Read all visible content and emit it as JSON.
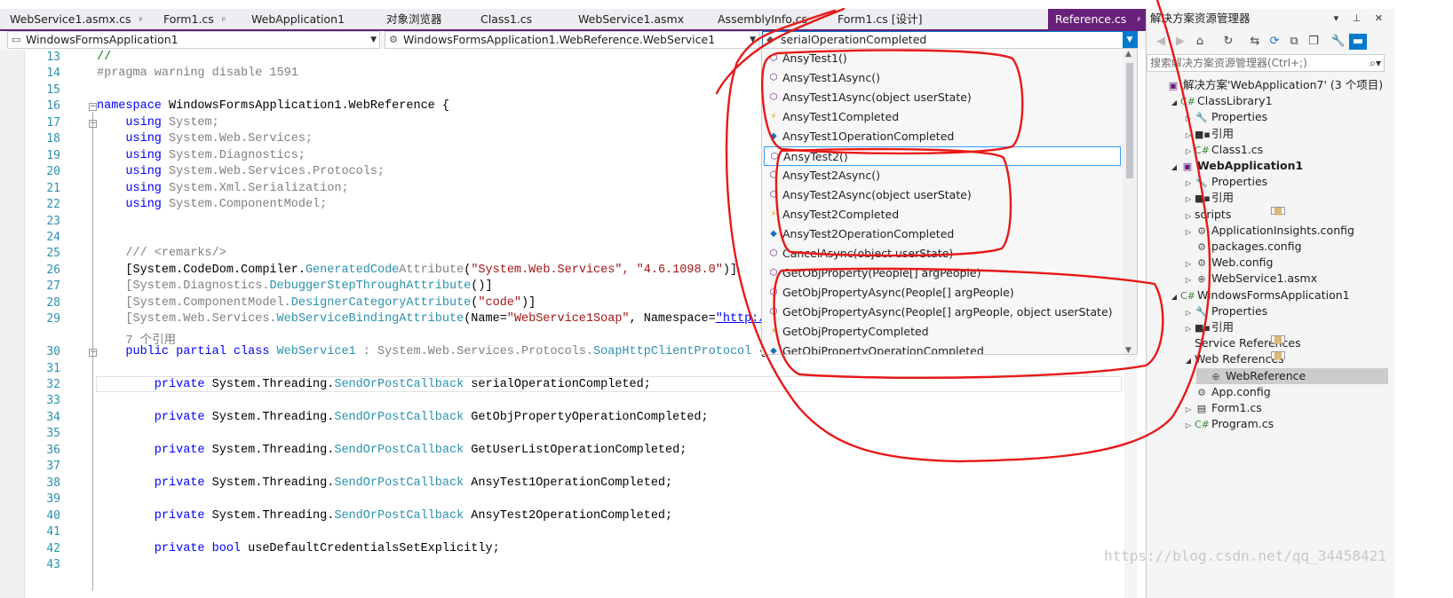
{
  "tabs": [
    {
      "label": "WebService1.asmx.cs",
      "pin": "ᵖ"
    },
    {
      "label": "Form1.cs",
      "pin": "ᵖ"
    },
    {
      "label": "WebApplication1",
      "pin": ""
    },
    {
      "label": "对象浏览器",
      "pin": ""
    },
    {
      "label": "Class1.cs",
      "pin": ""
    },
    {
      "label": "WebService1.asmx",
      "pin": ""
    },
    {
      "label": "AssemblyInfo.cs",
      "pin": ""
    },
    {
      "label": "Form1.cs [设计]",
      "pin": ""
    },
    {
      "label": "Reference.cs",
      "pin": "ᵖ",
      "close": "✕",
      "active": true
    }
  ],
  "tab_overflow": "▾",
  "navbar": {
    "project_combo": "WindowsFormsApplication1",
    "type_combo": "WindowsFormsApplication1.WebReference.WebService1",
    "member_combo": "serialOperationCompleted"
  },
  "editor": {
    "lines": [
      {
        "n": "13",
        "segments": [
          {
            "t": "//",
            "c": "cm"
          }
        ]
      },
      {
        "n": "14",
        "segments": [
          {
            "t": "#pragma warning disable 1591",
            "c": "gr"
          }
        ]
      },
      {
        "n": "15",
        "segments": []
      },
      {
        "n": "16",
        "segments": [
          {
            "t": "namespace",
            "c": "kw"
          },
          {
            "t": " WindowsFormsApplication1.WebReference {",
            "c": ""
          }
        ]
      },
      {
        "n": "17",
        "segments": [
          {
            "t": "    using",
            "c": "kw"
          },
          {
            "t": " System;",
            "c": "gr"
          }
        ]
      },
      {
        "n": "18",
        "segments": [
          {
            "t": "    using",
            "c": "kw"
          },
          {
            "t": " System.Web.Services;",
            "c": "gr"
          }
        ]
      },
      {
        "n": "19",
        "segments": [
          {
            "t": "    using",
            "c": "kw"
          },
          {
            "t": " System.Diagnostics;",
            "c": "gr"
          }
        ]
      },
      {
        "n": "20",
        "segments": [
          {
            "t": "    using",
            "c": "kw"
          },
          {
            "t": " System.Web.Services.Protocols;",
            "c": "gr"
          }
        ]
      },
      {
        "n": "21",
        "segments": [
          {
            "t": "    using",
            "c": "kw"
          },
          {
            "t": " System.Xml.Serialization;",
            "c": "gr"
          }
        ]
      },
      {
        "n": "22",
        "segments": [
          {
            "t": "    using",
            "c": "kw"
          },
          {
            "t": " System.ComponentModel;",
            "c": "gr"
          }
        ]
      },
      {
        "n": "23",
        "segments": []
      },
      {
        "n": "24",
        "segments": []
      },
      {
        "n": "25",
        "segments": [
          {
            "t": "    /// <remarks/>",
            "c": "gr"
          }
        ]
      },
      {
        "n": "26",
        "segments": [
          {
            "t": "    [System.CodeDom.Compiler.",
            "c": ""
          },
          {
            "t": "GeneratedCode",
            "c": "ty"
          },
          {
            "t": "Attribute",
            "c": "gr"
          },
          {
            "t": "(",
            "c": ""
          },
          {
            "t": "\"System.Web.Services\", \"4.6.1098.0\"",
            "c": "str"
          },
          {
            "t": ")]",
            "c": ""
          }
        ]
      },
      {
        "n": "27",
        "segments": [
          {
            "t": "    [System.Diagnostics.",
            "c": "gr"
          },
          {
            "t": "DebuggerStepThroughAttribute",
            "c": "ty"
          },
          {
            "t": "()]",
            "c": ""
          }
        ]
      },
      {
        "n": "28",
        "segments": [
          {
            "t": "    [System.ComponentModel.",
            "c": "gr"
          },
          {
            "t": "DesignerCategoryAttribute",
            "c": "ty"
          },
          {
            "t": "(",
            "c": ""
          },
          {
            "t": "\"code\"",
            "c": "str"
          },
          {
            "t": ")]",
            "c": ""
          }
        ]
      },
      {
        "n": "29",
        "segments": [
          {
            "t": "    [System.Web.Services.",
            "c": "gr"
          },
          {
            "t": "WebServiceBindingAttribute",
            "c": "ty"
          },
          {
            "t": "(Name=",
            "c": ""
          },
          {
            "t": "\"WebService1Soap\"",
            "c": "str"
          },
          {
            "t": ", Namespace=",
            "c": ""
          },
          {
            "t": "\"http://tempuri.org/\"",
            "c": "lk"
          }
        ]
      },
      {
        "n": "",
        "segments": [
          {
            "t": "    7 个引用",
            "c": "gr"
          }
        ]
      },
      {
        "n": "30",
        "segments": [
          {
            "t": "    public partial class",
            "c": "kw"
          },
          {
            "t": " ",
            "c": ""
          },
          {
            "t": "WebService1",
            "c": "ty"
          },
          {
            "t": " : System.Web.Services.Protocols.",
            "c": "gr"
          },
          {
            "t": "SoapHttpClientProtocol",
            "c": "ty"
          },
          {
            "t": " {",
            "c": ""
          }
        ]
      },
      {
        "n": "31",
        "segments": []
      },
      {
        "n": "32",
        "segments": [
          {
            "t": "        private",
            "c": "kw"
          },
          {
            "t": " System.Threading.",
            "c": ""
          },
          {
            "t": "SendOrPostCallback",
            "c": "ty"
          },
          {
            "t": " serialOperationCompleted;",
            "c": ""
          }
        ]
      },
      {
        "n": "33",
        "segments": []
      },
      {
        "n": "34",
        "segments": [
          {
            "t": "        private",
            "c": "kw"
          },
          {
            "t": " System.Threading.",
            "c": ""
          },
          {
            "t": "SendOrPostCallback",
            "c": "ty"
          },
          {
            "t": " GetObjPropertyOperationCompleted;",
            "c": ""
          }
        ]
      },
      {
        "n": "35",
        "segments": []
      },
      {
        "n": "36",
        "segments": [
          {
            "t": "        private",
            "c": "kw"
          },
          {
            "t": " System.Threading.",
            "c": ""
          },
          {
            "t": "SendOrPostCallback",
            "c": "ty"
          },
          {
            "t": " GetUserListOperationCompleted;",
            "c": ""
          }
        ]
      },
      {
        "n": "37",
        "segments": []
      },
      {
        "n": "38",
        "segments": [
          {
            "t": "        private",
            "c": "kw"
          },
          {
            "t": " System.Threading.",
            "c": ""
          },
          {
            "t": "SendOrPostCallback",
            "c": "ty"
          },
          {
            "t": " AnsyTest1OperationCompleted;",
            "c": ""
          }
        ]
      },
      {
        "n": "39",
        "segments": []
      },
      {
        "n": "40",
        "segments": [
          {
            "t": "        private",
            "c": "kw"
          },
          {
            "t": " System.Threading.",
            "c": ""
          },
          {
            "t": "SendOrPostCallback",
            "c": "ty"
          },
          {
            "t": " AnsyTest2OperationCompleted;",
            "c": ""
          }
        ]
      },
      {
        "n": "41",
        "segments": []
      },
      {
        "n": "42",
        "segments": [
          {
            "t": "        private bool",
            "c": "kw"
          },
          {
            "t": " useDefaultCredentialsSetExplicitly;",
            "c": ""
          }
        ]
      },
      {
        "n": "43",
        "segments": []
      }
    ]
  },
  "member_dropdown": {
    "items": [
      {
        "label": "AnsyTest1()",
        "icon": "⬡",
        "kind": "m"
      },
      {
        "label": "AnsyTest1Async()",
        "icon": "⬡",
        "kind": "m"
      },
      {
        "label": "AnsyTest1Async(object userState)",
        "icon": "⬡",
        "kind": "m"
      },
      {
        "label": "AnsyTest1Completed",
        "icon": "⚡",
        "kind": "e"
      },
      {
        "label": "AnsyTest1OperationCompleted",
        "icon": "◆",
        "kind": "f"
      },
      {
        "label": "AnsyTest2()",
        "icon": "⬡",
        "kind": "m",
        "selected": true
      },
      {
        "label": "AnsyTest2Async()",
        "icon": "⬡",
        "kind": "m"
      },
      {
        "label": "AnsyTest2Async(object userState)",
        "icon": "⬡",
        "kind": "m"
      },
      {
        "label": "AnsyTest2Completed",
        "icon": "⚡",
        "kind": "e"
      },
      {
        "label": "AnsyTest2OperationCompleted",
        "icon": "◆",
        "kind": "f"
      },
      {
        "label": "CancelAsync(object userState)",
        "icon": "⬡",
        "kind": "m"
      },
      {
        "label": "GetObjProperty(People[] argPeople)",
        "icon": "⬡",
        "kind": "m"
      },
      {
        "label": "GetObjPropertyAsync(People[] argPeople)",
        "icon": "⬡",
        "kind": "m"
      },
      {
        "label": "GetObjPropertyAsync(People[] argPeople, object userState)",
        "icon": "⬡",
        "kind": "m"
      },
      {
        "label": "GetObjPropertyCompleted",
        "icon": "⚡",
        "kind": "e"
      },
      {
        "label": "GetObjPropertyOperationCompleted",
        "icon": "◆",
        "kind": "f"
      }
    ]
  },
  "solution_explorer": {
    "title": "解决方案资源管理器",
    "controls": "▾ ⊥ ✕",
    "search_placeholder": "搜索解决方案资源管理器(Ctrl+;)",
    "tree": [
      {
        "label": "解决方案'WebApplication7' (3 个项目)",
        "depth": 0,
        "twisty": "",
        "icon": "▣",
        "iclass": "sol"
      },
      {
        "label": "ClassLibrary1",
        "depth": 1,
        "twisty": "◢",
        "icon": "C#",
        "iclass": "cs"
      },
      {
        "label": "Properties",
        "depth": 2,
        "twisty": "▷",
        "icon": "🔧",
        "iclass": "wrench"
      },
      {
        "label": "引用",
        "depth": 2,
        "twisty": "▷",
        "icon": "■▪",
        "iclass": "ref"
      },
      {
        "label": "Class1.cs",
        "depth": 2,
        "twisty": "▷",
        "icon": "C#",
        "iclass": "cs"
      },
      {
        "label": "WebApplication1",
        "depth": 1,
        "twisty": "◢",
        "icon": "▣",
        "iclass": "proj",
        "bold": true
      },
      {
        "label": "Properties",
        "depth": 2,
        "twisty": "▷",
        "icon": "🔧",
        "iclass": "wrench"
      },
      {
        "label": "引用",
        "depth": 2,
        "twisty": "▷",
        "icon": "■▪",
        "iclass": "ref"
      },
      {
        "label": "scripts",
        "depth": 2,
        "twisty": "▷",
        "icon": "■",
        "iclass": "fold"
      },
      {
        "label": "ApplicationInsights.config",
        "depth": 2,
        "twisty": "▷",
        "icon": "⚙",
        "iclass": "cfg"
      },
      {
        "label": "packages.config",
        "depth": 2,
        "twisty": "",
        "icon": "⚙",
        "iclass": "cfg"
      },
      {
        "label": "Web.config",
        "depth": 2,
        "twisty": "▷",
        "icon": "⚙",
        "iclass": "cfg"
      },
      {
        "label": "WebService1.asmx",
        "depth": 2,
        "twisty": "▷",
        "icon": "⊕",
        "iclass": "cfg"
      },
      {
        "label": "WindowsFormsApplication1",
        "depth": 1,
        "twisty": "◢",
        "icon": "C#",
        "iclass": "cs"
      },
      {
        "label": "Properties",
        "depth": 2,
        "twisty": "▷",
        "icon": "🔧",
        "iclass": "wrench"
      },
      {
        "label": "引用",
        "depth": 2,
        "twisty": "▷",
        "icon": "■▪",
        "iclass": "ref"
      },
      {
        "label": "Service References",
        "depth": 2,
        "twisty": "",
        "icon": "■",
        "iclass": "fold"
      },
      {
        "label": "Web References",
        "depth": 2,
        "twisty": "◢",
        "icon": "■",
        "iclass": "fold"
      },
      {
        "label": "WebReference",
        "depth": 3,
        "twisty": "",
        "icon": "⊕",
        "iclass": "cfg",
        "selected": true
      },
      {
        "label": "App.config",
        "depth": 2,
        "twisty": "",
        "icon": "⚙",
        "iclass": "cfg"
      },
      {
        "label": "Form1.cs",
        "depth": 2,
        "twisty": "▷",
        "icon": "▤",
        "iclass": "ref"
      },
      {
        "label": "Program.cs",
        "depth": 2,
        "twisty": "▷",
        "icon": "C#",
        "iclass": "cs"
      }
    ]
  },
  "watermark": "https://blog.csdn.net/qq_34458421"
}
